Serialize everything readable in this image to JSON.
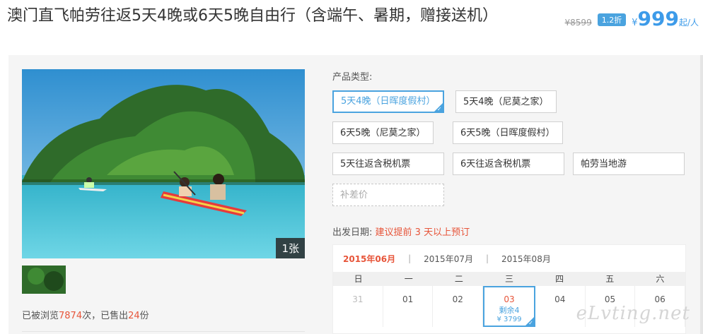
{
  "title": "澳门直飞帕劳往返5天4晚或6天5晚自由行（含端午、暑期，赠接送机）",
  "price": {
    "old": "¥8599",
    "discount": "1.2折",
    "currency": "¥",
    "amount": "999",
    "unit": "起/人"
  },
  "gallery": {
    "photo_count": "1张"
  },
  "stats": {
    "prefix": "已被浏览",
    "views": "7874",
    "mid": "次，已售出",
    "sold": "24",
    "suffix": "份"
  },
  "product": {
    "label": "产品类型:",
    "options": [
      "5天4晚（日晖度假村）",
      "5天4晚（尼莫之家）",
      "6天5晚（尼莫之家）",
      "6天5晚（日晖度假村）",
      "5天往返含税机票",
      "6天往返含税机票",
      "帕劳当地游",
      "补差价"
    ],
    "selected_index": 0
  },
  "departure": {
    "label": "出发日期:",
    "hint": "建议提前 3 天以上预订"
  },
  "calendar": {
    "months": [
      "2015年06月",
      "2015年07月",
      "2015年08月"
    ],
    "active_month": 0,
    "weekdays": [
      "日",
      "一",
      "二",
      "三",
      "四",
      "五",
      "六"
    ],
    "days": [
      {
        "day": "31",
        "past": true
      },
      {
        "day": "01"
      },
      {
        "day": "02"
      },
      {
        "day": "03",
        "selected": true,
        "remaining": "剩余4",
        "price": "¥ 3799"
      },
      {
        "day": "04"
      },
      {
        "day": "05"
      },
      {
        "day": "06"
      }
    ]
  },
  "watermark": "eLvting.net",
  "colors": {
    "accent": "#4aa3df",
    "highlight": "#e7553a"
  }
}
